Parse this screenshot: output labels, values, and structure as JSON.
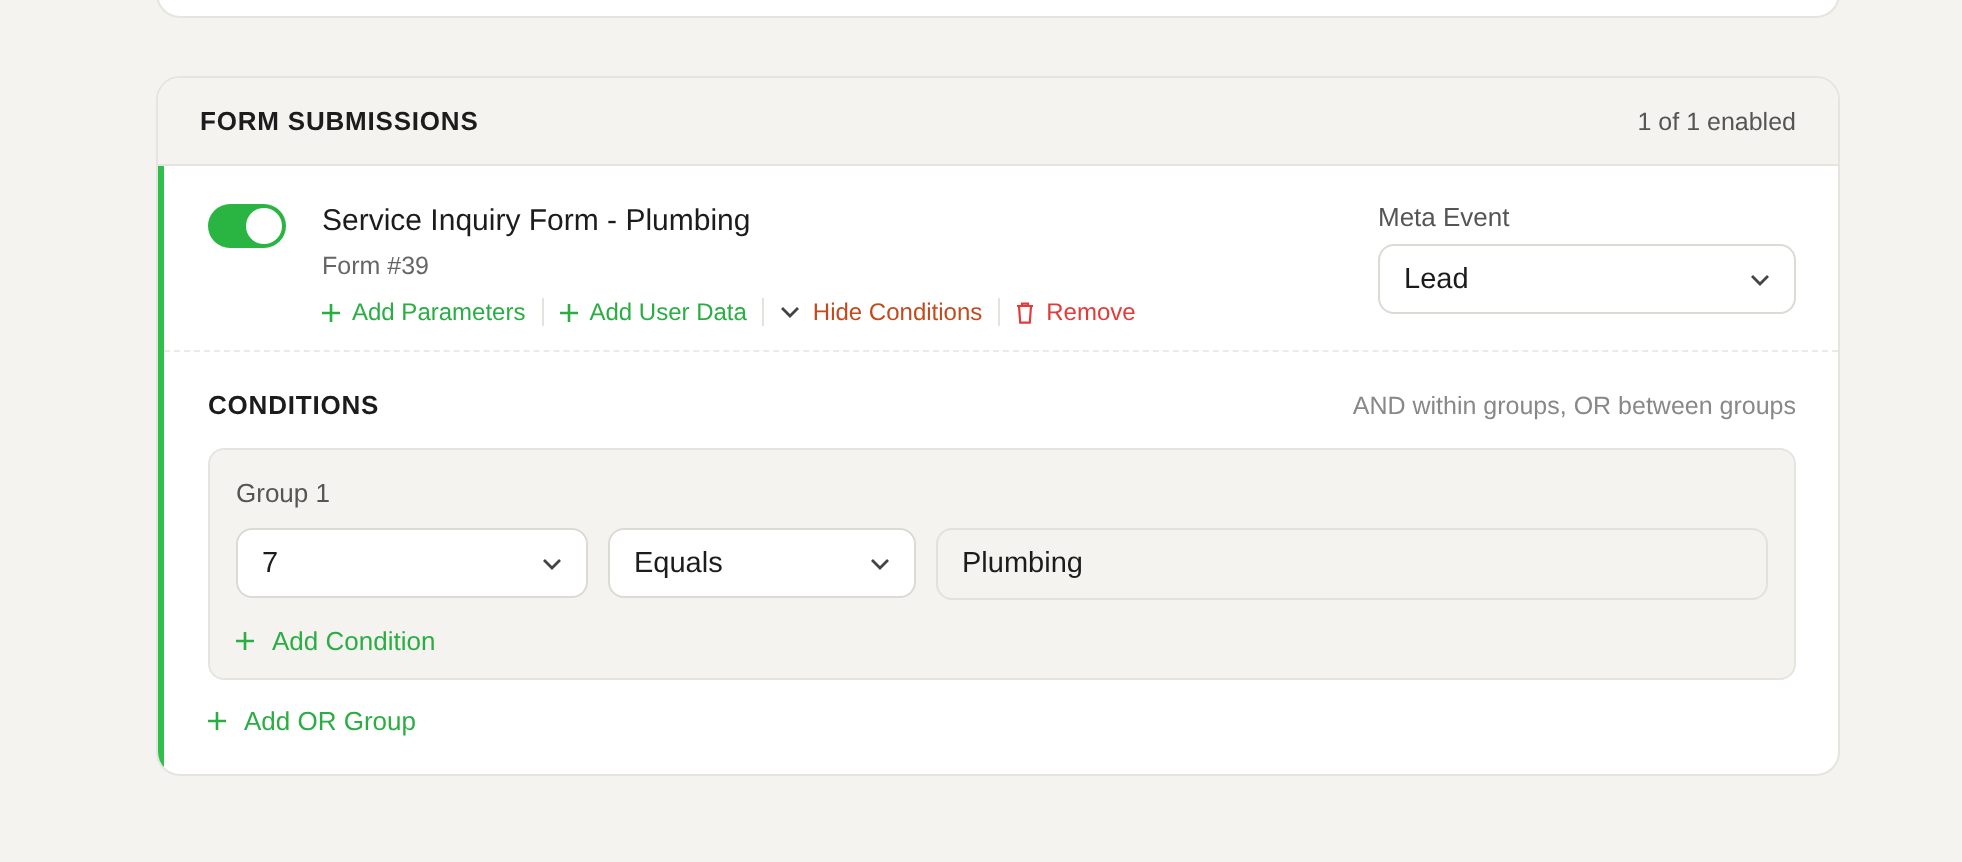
{
  "section": {
    "title": "FORM SUBMISSIONS",
    "summary": "1 of 1 enabled"
  },
  "form": {
    "enabled": true,
    "name": "Service Inquiry Form - Plumbing",
    "subtitle": "Form #39",
    "actions": [
      {
        "kind": "add",
        "label": "Add Parameters"
      },
      {
        "kind": "add",
        "label": "Add User Data"
      },
      {
        "kind": "collapse",
        "label": "Hide Conditions"
      },
      {
        "kind": "remove",
        "label": "Remove"
      }
    ],
    "event_label": "Meta Event",
    "event_value": "Lead"
  },
  "conditions": {
    "title": "CONDITIONS",
    "hint": "AND within groups, OR between groups",
    "groups": [
      {
        "label": "Group 1",
        "rows": [
          {
            "field": "7",
            "operator": "Equals",
            "value": "Plumbing"
          }
        ],
        "add_label": "Add Condition"
      }
    ],
    "add_group_label": "Add OR Group"
  }
}
